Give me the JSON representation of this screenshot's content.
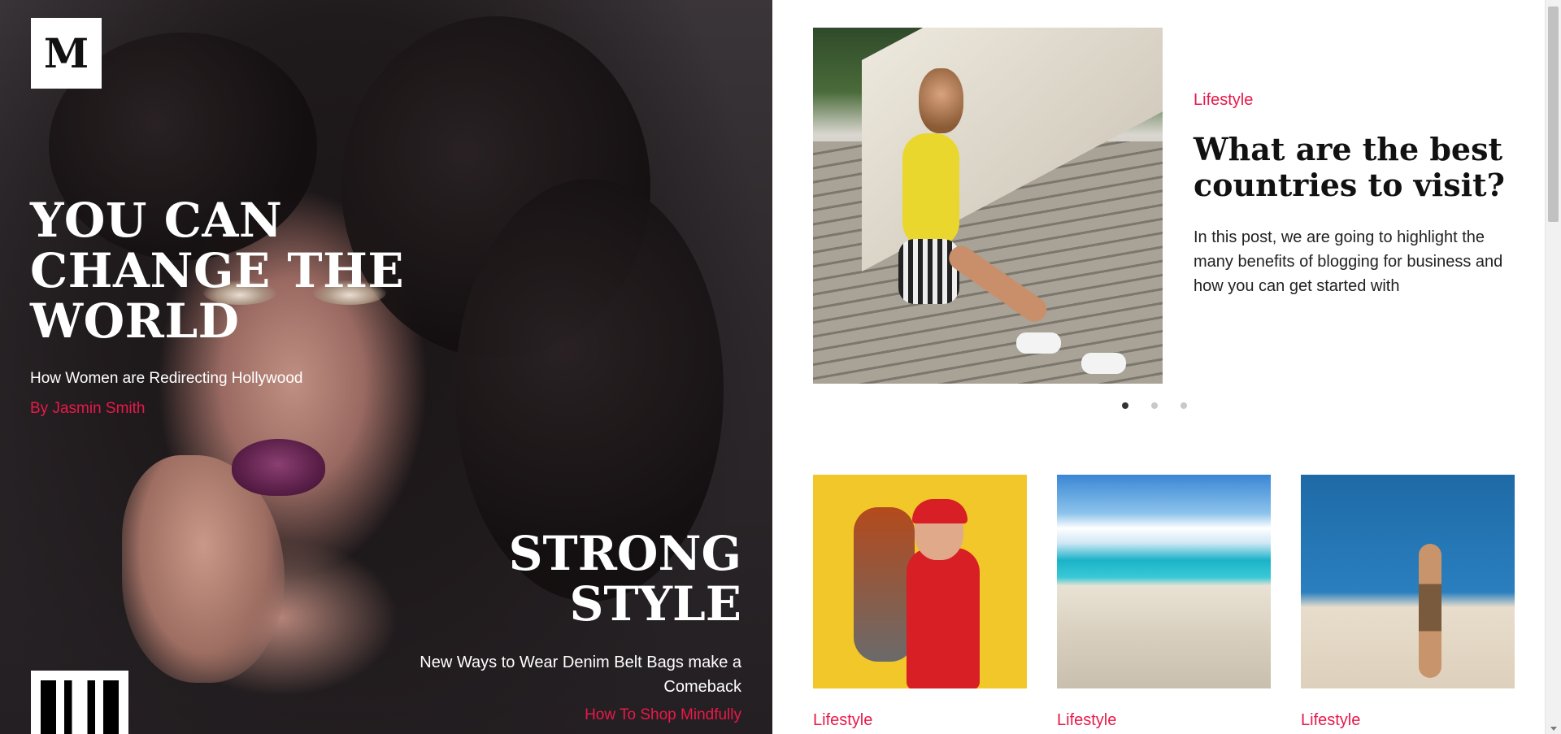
{
  "brand": {
    "logo_letter": "M"
  },
  "hero": {
    "title": "YOU CAN CHANGE THE WORLD",
    "subtitle": "How Women are Redirecting Hollywood",
    "author": "By Jasmin Smith"
  },
  "secondary": {
    "title": "STRONG STYLE",
    "subtitle": "New Ways to Wear Denim Belt Bags make a Comeback",
    "link": "How To Shop Mindfully"
  },
  "featured": {
    "category": "Lifestyle",
    "title": "What are the best countries to visit?",
    "excerpt": "In this post, we are going to highlight the many benefits of blogging for business and how you can get started with",
    "slides_total": 3,
    "active_slide": 1
  },
  "cards": [
    {
      "category": "Lifestyle"
    },
    {
      "category": "Lifestyle"
    },
    {
      "category": "Lifestyle"
    }
  ],
  "colors": {
    "accent": "#e8194a",
    "dark": "#111111"
  }
}
